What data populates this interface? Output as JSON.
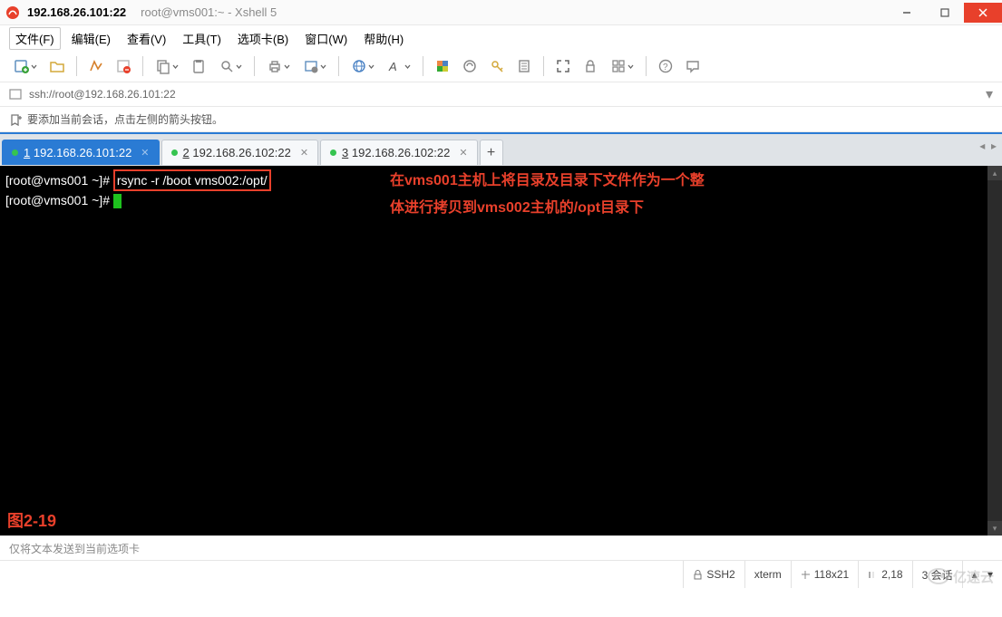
{
  "window": {
    "title_host": "192.168.26.101:22",
    "title_suffix": "root@vms001:~ - Xshell 5"
  },
  "menu": {
    "file": "文件(F)",
    "edit": "编辑(E)",
    "view": "查看(V)",
    "tools": "工具(T)",
    "tabs": "选项卡(B)",
    "window": "窗口(W)",
    "help": "帮助(H)"
  },
  "toolbar_icons": {
    "new": "new-session-icon",
    "open": "open-icon",
    "reconnect": "reconnect-icon",
    "disconnect": "disconnect-icon",
    "copy": "copy-icon",
    "paste": "paste-icon",
    "find": "find-icon",
    "print": "print-icon",
    "properties": "properties-icon",
    "globe": "globe-icon",
    "font": "font-icon",
    "color": "color-icon",
    "tunnel": "tunnel-icon",
    "key": "key-icon",
    "scroll": "scroll-icon",
    "fullscreen": "fullscreen-icon",
    "lock": "lock-icon",
    "tile": "tile-icon",
    "help": "help-icon",
    "chat": "chat-icon"
  },
  "addressbar": {
    "url": "ssh://root@192.168.26.101:22"
  },
  "hint": "要添加当前会话，点击左侧的箭头按钮。",
  "tabs": [
    {
      "num": "1",
      "label": "192.168.26.101:22",
      "active": true
    },
    {
      "num": "2",
      "label": "192.168.26.102:22",
      "active": false
    },
    {
      "num": "3",
      "label": "192.168.26.102:22",
      "active": false
    }
  ],
  "terminal": {
    "line1_prompt": "[root@vms001 ~]# ",
    "line1_cmd": "rsync -r /boot vms002:/opt/",
    "line2_prompt": "[root@vms001 ~]# ",
    "annotation_l1": "在vms001主机上将目录及目录下文件作为一个整",
    "annotation_l2": "体进行拷贝到vms002主机的/opt目录下",
    "fig_label": "图2-19"
  },
  "inputhint": "仅将文本发送到当前选项卡",
  "status": {
    "protocol": "SSH2",
    "term": "xterm",
    "size": "118x21",
    "pos": "2,18",
    "sessions_label": "3 会话"
  },
  "watermark": "亿速云",
  "colors": {
    "accent_red": "#e8402b",
    "tab_blue": "#2a7bd4",
    "active_dot": "#36c450"
  }
}
